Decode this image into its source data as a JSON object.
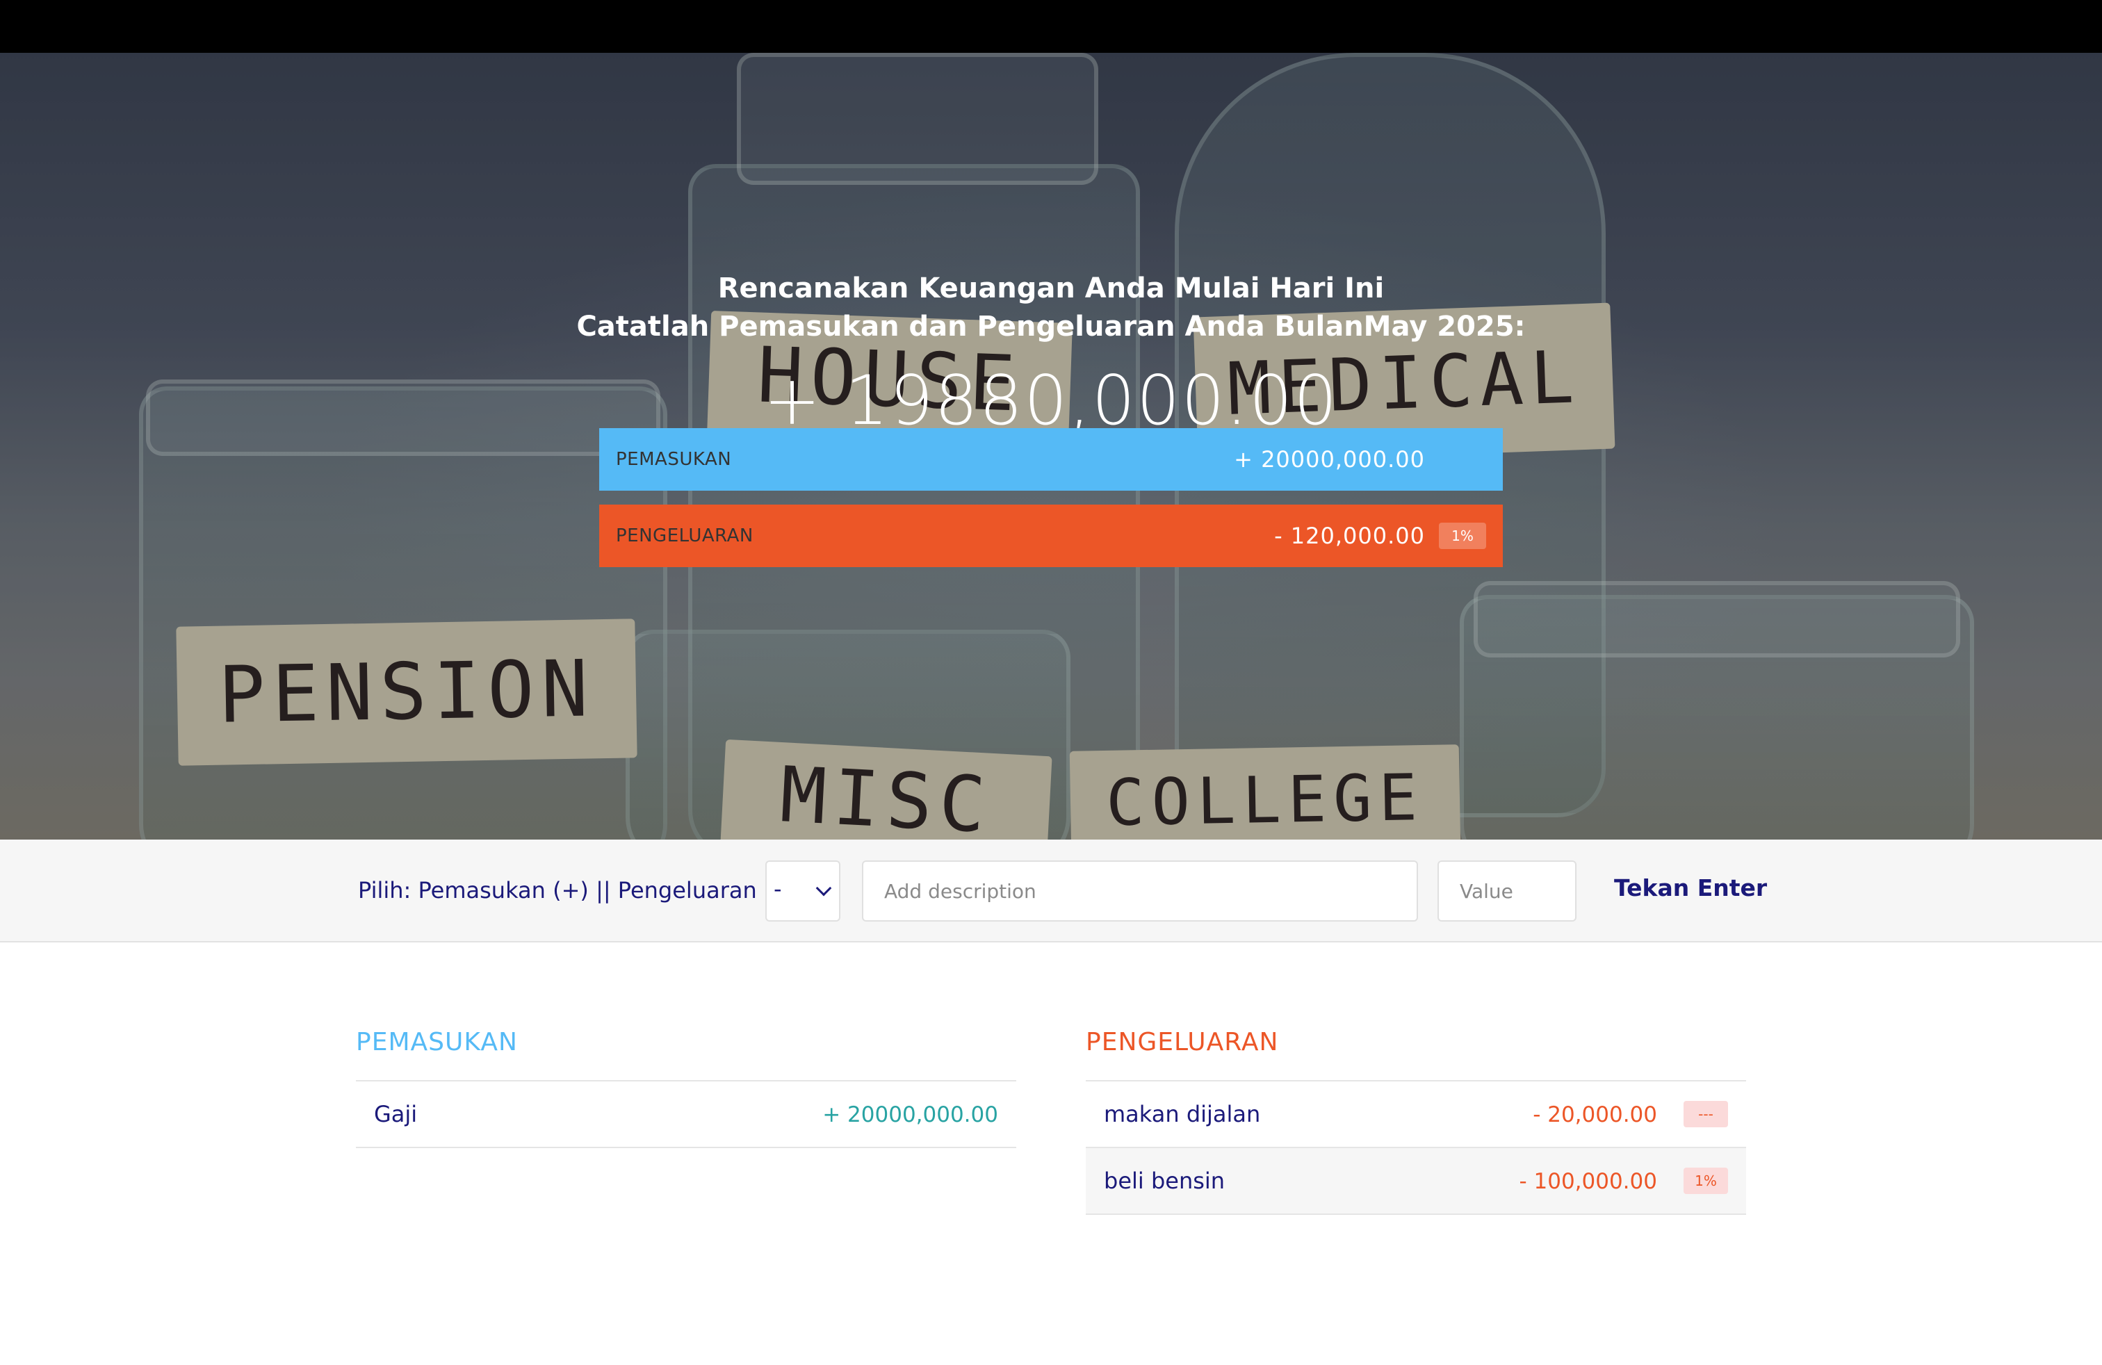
{
  "header": {
    "line1": "Rencanakan Keuangan Anda Mulai Hari Ini",
    "line2": "Catatlah Pemasukan dan Pengeluaran Anda BulanMay 2025:",
    "total": "+ 19880,000.00"
  },
  "hero_image": {
    "jar_labels": [
      "HOUSE",
      "MEDICAL",
      "PENSION",
      "MISC",
      "COLLEGE"
    ]
  },
  "summary": {
    "income": {
      "label": "PEMASUKAN",
      "value": "+ 20000,000.00"
    },
    "expense": {
      "label": "PENGELUARAN",
      "value": "- 120,000.00",
      "percent": "1%"
    }
  },
  "add_form": {
    "type_label": "Pilih: Pemasukan (+) || Pengeluaran (-)",
    "type_selected": "-",
    "description_placeholder": "Add description",
    "value_placeholder": "Value",
    "submit_label": "Tekan Enter"
  },
  "income_list": {
    "title": "PEMASUKAN",
    "items": [
      {
        "description": "Gaji",
        "value": "+ 20000,000.00"
      }
    ]
  },
  "expense_list": {
    "title": "PENGELUARAN",
    "items": [
      {
        "description": "makan dijalan",
        "value": "- 20,000.00",
        "percent": "---"
      },
      {
        "description": "beli bensin",
        "value": "- 100,000.00",
        "percent": "1%"
      }
    ]
  },
  "colors": {
    "income": "#55baf6",
    "expense": "#ec5627",
    "income_value": "#28a3a3",
    "text_dark": "#1b1a7a"
  }
}
